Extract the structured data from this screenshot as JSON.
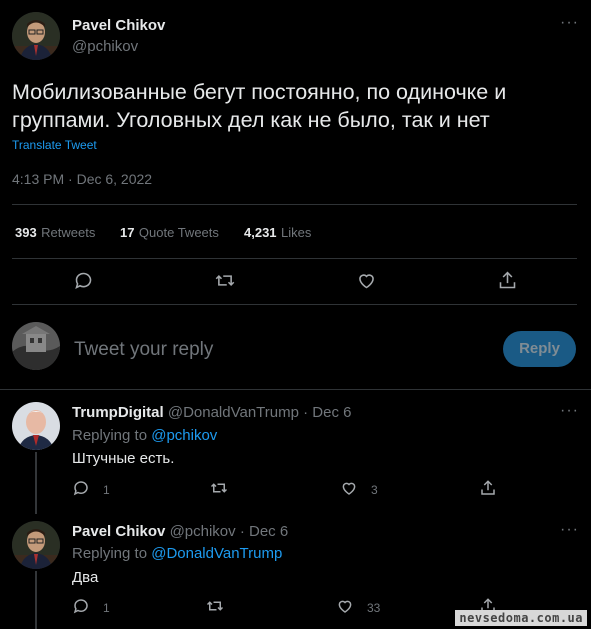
{
  "main_tweet": {
    "author_name": "Pavel Chikov",
    "author_handle": "@pchikov",
    "text": "Мобилизованные бегут постоянно, по одиночке и группами. Уголовных дел как не было, так и нет",
    "translate_label": "Translate Tweet",
    "timestamp": "4:13 PM · Dec 6, 2022",
    "stats": {
      "retweets_count": "393",
      "retweets_label": "Retweets",
      "quotes_count": "17",
      "quotes_label": "Quote Tweets",
      "likes_count": "4,231",
      "likes_label": "Likes"
    }
  },
  "composer": {
    "placeholder": "Tweet your reply",
    "reply_button": "Reply"
  },
  "replies": [
    {
      "author_name": "TrumpDigital",
      "author_handle": "@DonaldVanTrump",
      "date": "· Dec 6",
      "replying_prefix": "Replying to",
      "replying_to": "@pchikov",
      "text": "Штучные есть.",
      "reply_count": "1",
      "retweet_count": "",
      "like_count": "3"
    },
    {
      "author_name": "Pavel Chikov",
      "author_handle": "@pchikov",
      "date": "· Dec 6",
      "replying_prefix": "Replying to",
      "replying_to": "@DonaldVanTrump",
      "text": "Два",
      "reply_count": "1",
      "retweet_count": "",
      "like_count": "33"
    }
  ],
  "watermark": "nevsedoma.com.ua",
  "colors": {
    "background": "#000000",
    "text": "#e7e9ea",
    "muted": "#71767b",
    "accent": "#1d9bf0"
  }
}
